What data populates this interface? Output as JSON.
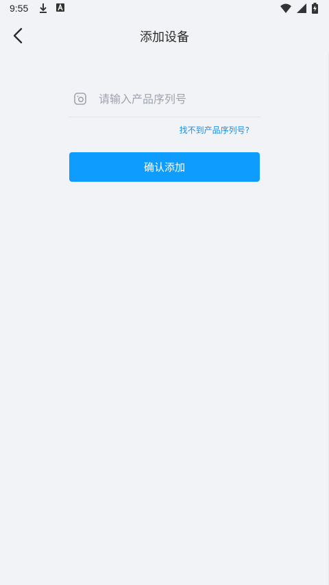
{
  "status_bar": {
    "time": "9:55",
    "icons": [
      "download-icon",
      "app-a-icon",
      "wifi-icon",
      "signal-icon",
      "battery-charging-icon"
    ]
  },
  "header": {
    "title": "添加设备",
    "back_icon": "chevron-left-icon"
  },
  "form": {
    "serial_placeholder": "请输入产品序列号",
    "serial_value": "",
    "field_icon": "camera-scan-icon",
    "help_link": "找不到产品序列号?",
    "confirm_label": "确认添加"
  },
  "colors": {
    "background": "#f2f3f7",
    "accent": "#0f9cff",
    "link": "#1b8ee8",
    "placeholder": "#9ea3ac"
  }
}
